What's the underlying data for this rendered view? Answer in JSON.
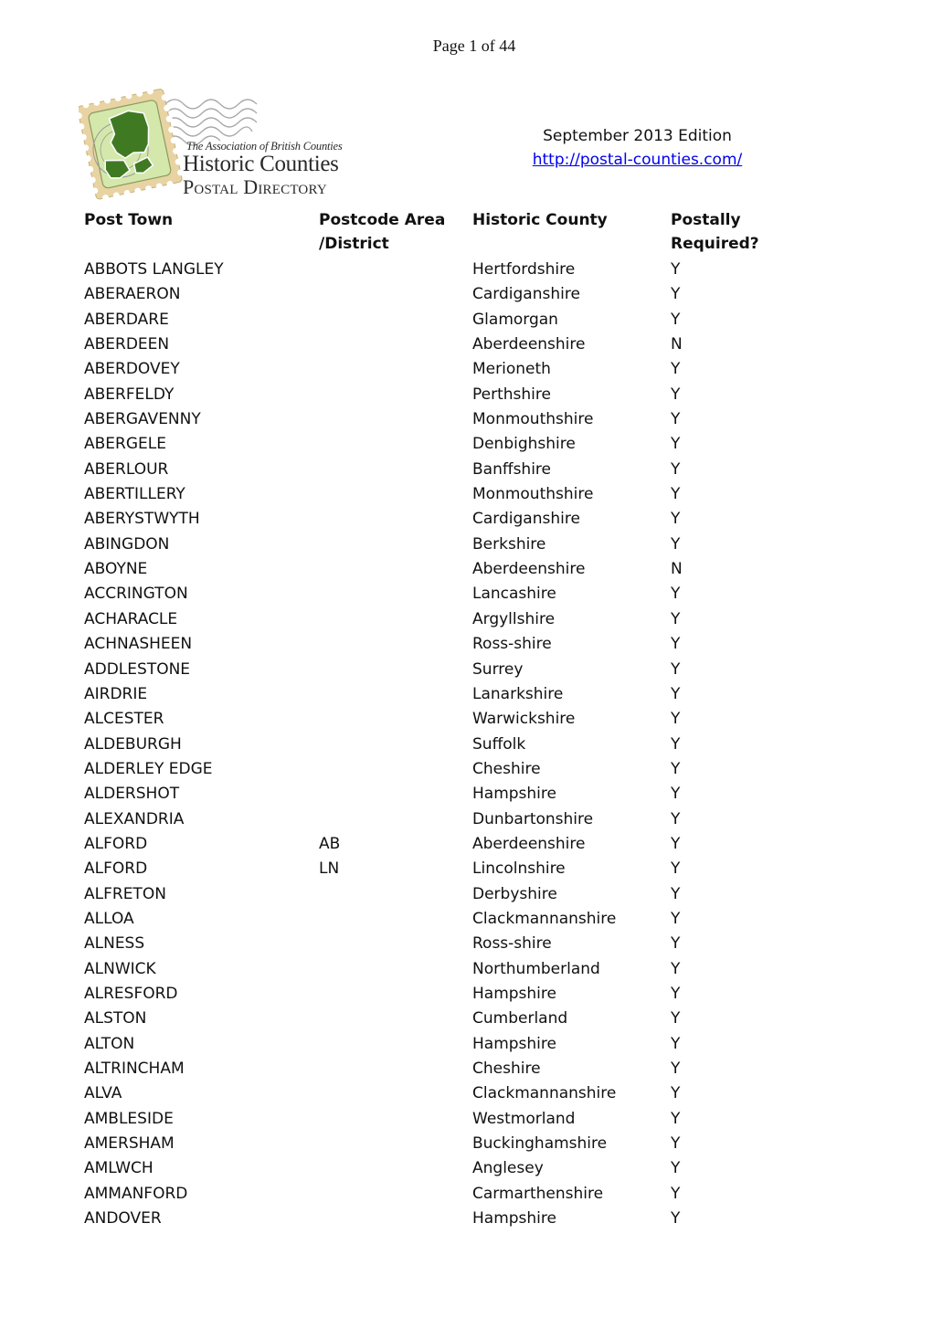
{
  "page_header": {
    "page_label": "Page 1 of 44"
  },
  "logo": {
    "association": "The Association of British Counties",
    "title_line1": "Historic Counties",
    "title_line2": "Postal Directory",
    "colors": {
      "stamp_border": "#e8d3a3",
      "stamp_inner": "#d2e6a8",
      "map_green": "#3f7a23",
      "postmark_lines": "#9a9a9a"
    }
  },
  "edition": {
    "label": "September 2013 Edition",
    "link_text": "http://postal-counties.com/",
    "link_color": "#0000ee"
  },
  "table": {
    "headers": {
      "post_town": "Post Town",
      "postcode_line1": "Postcode Area",
      "postcode_line2": "/District",
      "historic_county": "Historic County",
      "required_line1": "Postally",
      "required_line2": "Required?"
    },
    "rows": [
      {
        "town": "ABBOTS LANGLEY",
        "postcode": "",
        "county": "Hertfordshire",
        "required": "Y"
      },
      {
        "town": "ABERAERON",
        "postcode": "",
        "county": "Cardiganshire",
        "required": "Y"
      },
      {
        "town": "ABERDARE",
        "postcode": "",
        "county": "Glamorgan",
        "required": "Y"
      },
      {
        "town": "ABERDEEN",
        "postcode": "",
        "county": "Aberdeenshire",
        "required": "N"
      },
      {
        "town": "ABERDOVEY",
        "postcode": "",
        "county": "Merioneth",
        "required": "Y"
      },
      {
        "town": "ABERFELDY",
        "postcode": "",
        "county": "Perthshire",
        "required": "Y"
      },
      {
        "town": "ABERGAVENNY",
        "postcode": "",
        "county": "Monmouthshire",
        "required": "Y"
      },
      {
        "town": "ABERGELE",
        "postcode": "",
        "county": "Denbighshire",
        "required": "Y"
      },
      {
        "town": "ABERLOUR",
        "postcode": "",
        "county": "Banffshire",
        "required": "Y"
      },
      {
        "town": "ABERTILLERY",
        "postcode": "",
        "county": "Monmouthshire",
        "required": "Y"
      },
      {
        "town": "ABERYSTWYTH",
        "postcode": "",
        "county": "Cardiganshire",
        "required": "Y"
      },
      {
        "town": "ABINGDON",
        "postcode": "",
        "county": "Berkshire",
        "required": "Y"
      },
      {
        "town": "ABOYNE",
        "postcode": "",
        "county": "Aberdeenshire",
        "required": "N"
      },
      {
        "town": "ACCRINGTON",
        "postcode": "",
        "county": "Lancashire",
        "required": "Y"
      },
      {
        "town": "ACHARACLE",
        "postcode": "",
        "county": "Argyllshire",
        "required": "Y"
      },
      {
        "town": "ACHNASHEEN",
        "postcode": "",
        "county": "Ross-shire",
        "required": "Y"
      },
      {
        "town": "ADDLESTONE",
        "postcode": "",
        "county": "Surrey",
        "required": "Y"
      },
      {
        "town": "AIRDRIE",
        "postcode": "",
        "county": "Lanarkshire",
        "required": "Y"
      },
      {
        "town": "ALCESTER",
        "postcode": "",
        "county": "Warwickshire",
        "required": "Y"
      },
      {
        "town": "ALDEBURGH",
        "postcode": "",
        "county": "Suffolk",
        "required": "Y"
      },
      {
        "town": "ALDERLEY EDGE",
        "postcode": "",
        "county": "Cheshire",
        "required": "Y"
      },
      {
        "town": "ALDERSHOT",
        "postcode": "",
        "county": "Hampshire",
        "required": "Y"
      },
      {
        "town": "ALEXANDRIA",
        "postcode": "",
        "county": "Dunbartonshire",
        "required": "Y"
      },
      {
        "town": "ALFORD",
        "postcode": "AB",
        "county": "Aberdeenshire",
        "required": "Y"
      },
      {
        "town": "ALFORD",
        "postcode": "LN",
        "county": "Lincolnshire",
        "required": "Y"
      },
      {
        "town": "ALFRETON",
        "postcode": "",
        "county": "Derbyshire",
        "required": "Y"
      },
      {
        "town": "ALLOA",
        "postcode": "",
        "county": "Clackmannanshire",
        "required": "Y"
      },
      {
        "town": "ALNESS",
        "postcode": "",
        "county": "Ross-shire",
        "required": "Y"
      },
      {
        "town": "ALNWICK",
        "postcode": "",
        "county": "Northumberland",
        "required": "Y"
      },
      {
        "town": "ALRESFORD",
        "postcode": "",
        "county": "Hampshire",
        "required": "Y"
      },
      {
        "town": "ALSTON",
        "postcode": "",
        "county": "Cumberland",
        "required": "Y"
      },
      {
        "town": "ALTON",
        "postcode": "",
        "county": "Hampshire",
        "required": "Y"
      },
      {
        "town": "ALTRINCHAM",
        "postcode": "",
        "county": "Cheshire",
        "required": "Y"
      },
      {
        "town": "ALVA",
        "postcode": "",
        "county": "Clackmannanshire",
        "required": "Y"
      },
      {
        "town": "AMBLESIDE",
        "postcode": "",
        "county": "Westmorland",
        "required": "Y"
      },
      {
        "town": "AMERSHAM",
        "postcode": "",
        "county": "Buckinghamshire",
        "required": "Y"
      },
      {
        "town": "AMLWCH",
        "postcode": "",
        "county": "Anglesey",
        "required": "Y"
      },
      {
        "town": "AMMANFORD",
        "postcode": "",
        "county": "Carmarthenshire",
        "required": "Y"
      },
      {
        "town": "ANDOVER",
        "postcode": "",
        "county": "Hampshire",
        "required": "Y"
      }
    ]
  }
}
